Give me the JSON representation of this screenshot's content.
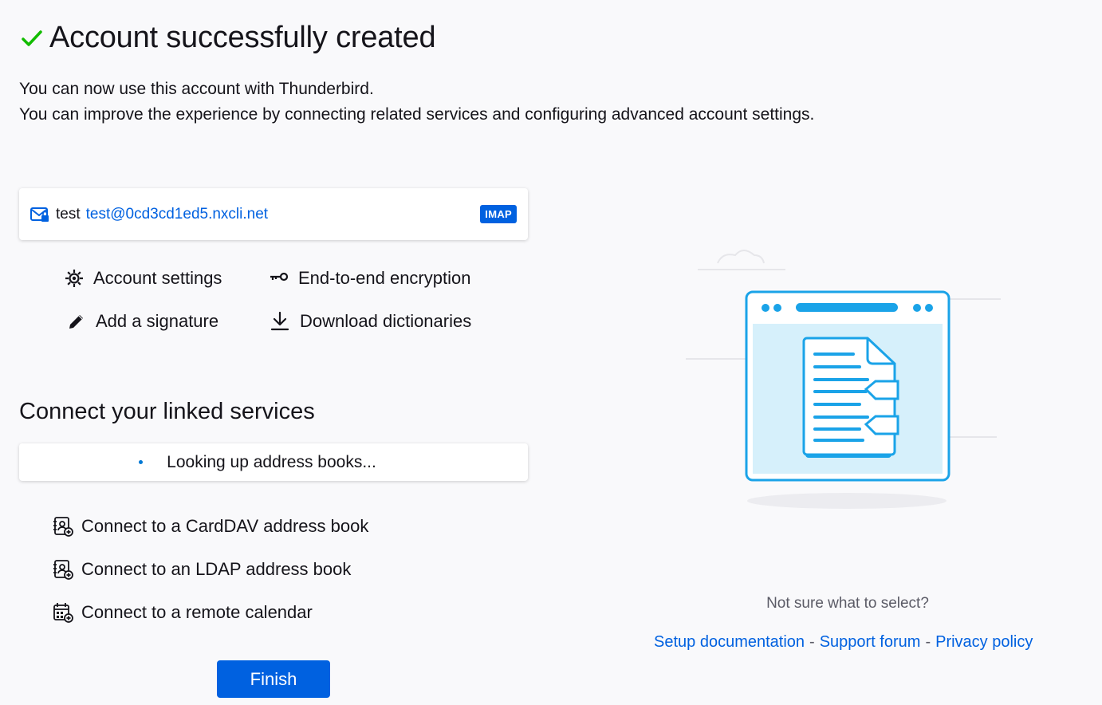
{
  "header": {
    "title": "Account successfully created",
    "success_color": "#12bc00"
  },
  "intro": {
    "line1": "You can now use this account with Thunderbird.",
    "line2": "You can improve the experience by connecting related services and configuring advanced account settings."
  },
  "account": {
    "name": "test",
    "email": "test@0cd3cd1ed5.nxcli.net",
    "protocol_badge": "IMAP",
    "icon": "mail-lock-icon"
  },
  "actions": [
    {
      "label": "Account settings",
      "icon": "gear-icon"
    },
    {
      "label": "End-to-end encryption",
      "icon": "key-icon"
    },
    {
      "label": "Add a signature",
      "icon": "pencil-icon"
    },
    {
      "label": "Download dictionaries",
      "icon": "download-icon"
    }
  ],
  "linked_services": {
    "title": "Connect your linked services",
    "status": "Looking up address books...",
    "items": [
      {
        "label": "Connect to a CardDAV address book",
        "icon": "address-book-add-icon"
      },
      {
        "label": "Connect to an LDAP address book",
        "icon": "address-book-add-icon"
      },
      {
        "label": "Connect to a remote calendar",
        "icon": "calendar-add-icon"
      }
    ]
  },
  "finish_label": "Finish",
  "help": {
    "question": "Not sure what to select?",
    "links": [
      "Setup documentation",
      "Support forum",
      "Privacy policy"
    ],
    "separator": "-"
  },
  "colors": {
    "accent": "#0061e0",
    "illustration_blue": "#1aa3e8",
    "illustration_fill": "#d6f0fb"
  }
}
